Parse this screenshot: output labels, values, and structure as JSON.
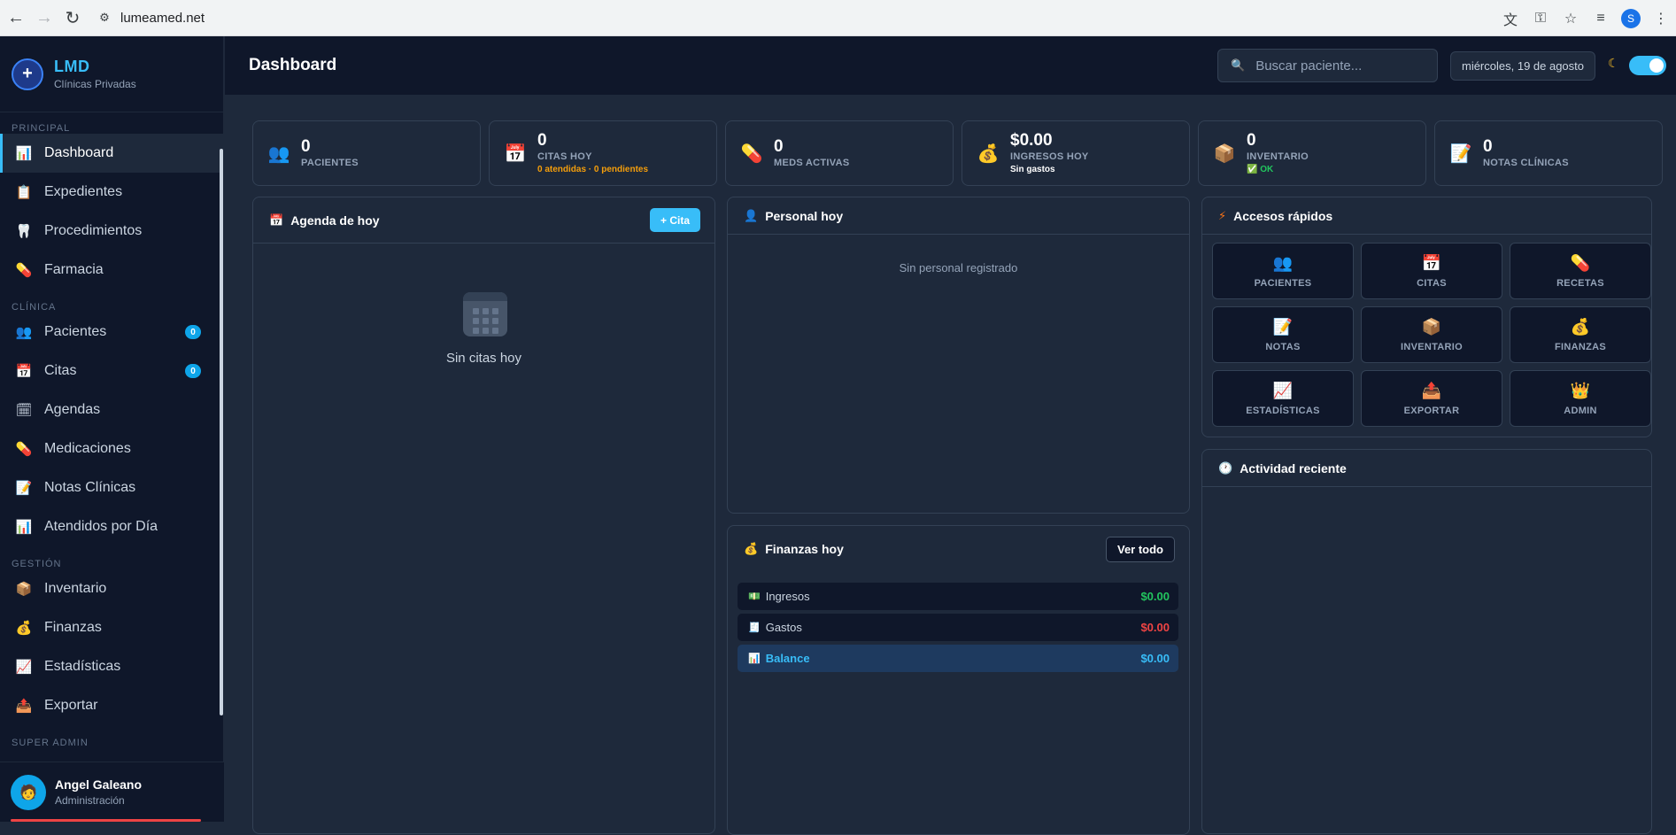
{
  "browser": {
    "url": "lumeamed.net",
    "profile_initial": "S"
  },
  "brand": {
    "name": "LMD",
    "subtitle": "Clínicas Privadas"
  },
  "sidebar": {
    "sections": [
      {
        "title": "PRINCIPAL",
        "items": [
          {
            "label": "Dashboard",
            "icon": "📊",
            "active": true
          },
          {
            "label": "Expedientes",
            "icon": "📋"
          },
          {
            "label": "Procedimientos",
            "icon": "🦷"
          },
          {
            "label": "Farmacia",
            "icon": "💊"
          }
        ]
      },
      {
        "title": "CLÍNICA",
        "items": [
          {
            "label": "Pacientes",
            "icon": "👥",
            "badge": "0"
          },
          {
            "label": "Citas",
            "icon": "📅",
            "badge": "0"
          },
          {
            "label": "Agendas",
            "icon": "🗓"
          },
          {
            "label": "Medicaciones",
            "icon": "💊"
          },
          {
            "label": "Notas Clínicas",
            "icon": "📝"
          },
          {
            "label": "Atendidos por Día",
            "icon": "📊"
          }
        ]
      },
      {
        "title": "GESTIÓN",
        "items": [
          {
            "label": "Inventario",
            "icon": "📦"
          },
          {
            "label": "Finanzas",
            "icon": "💰"
          },
          {
            "label": "Estadísticas",
            "icon": "📈"
          },
          {
            "label": "Exportar",
            "icon": "📤"
          }
        ]
      },
      {
        "title": "SUPER ADMIN",
        "items": []
      }
    ],
    "user": {
      "name": "Angel Galeano",
      "role": "Administración",
      "avatar_icon": "🧑"
    }
  },
  "header": {
    "title": "Dashboard",
    "search_placeholder": "Buscar paciente...",
    "date": "miércoles, 19 de agosto"
  },
  "stats": [
    {
      "value": "0",
      "label": "PACIENTES",
      "icon": "👥"
    },
    {
      "value": "0",
      "label": "CITAS HOY",
      "icon": "📅",
      "sub": "0 atendidas · 0 pendientes"
    },
    {
      "value": "0",
      "label": "MEDS ACTIVAS",
      "icon": "💊"
    },
    {
      "value": "$0.00",
      "label": "INGRESOS HOY",
      "icon": "💰",
      "sub": "Sin gastos"
    },
    {
      "value": "0",
      "label": "INVENTARIO",
      "icon": "📦",
      "sub": "✅ OK"
    },
    {
      "value": "0",
      "label": "NOTAS CLÍNICAS",
      "icon": "📝"
    }
  ],
  "agenda": {
    "title": "Agenda de hoy",
    "icon": "📅",
    "button": "+ Cita",
    "empty": "Sin citas hoy"
  },
  "personal": {
    "title": "Personal hoy",
    "icon": "👤",
    "empty": "Sin personal registrado"
  },
  "finanzas": {
    "title": "Finanzas hoy",
    "icon": "💰",
    "button": "Ver todo",
    "rows": [
      {
        "label": "Ingresos",
        "icon": "💵",
        "amount": "$0.00"
      },
      {
        "label": "Gastos",
        "icon": "🧾",
        "amount": "$0.00"
      },
      {
        "label": "Balance",
        "icon": "📊",
        "amount": "$0.00"
      }
    ]
  },
  "accesos": {
    "title": "Accesos rápidos",
    "icon": "⚡",
    "items": [
      {
        "label": "PACIENTES",
        "icon": "👥"
      },
      {
        "label": "CITAS",
        "icon": "📅"
      },
      {
        "label": "RECETAS",
        "icon": "💊"
      },
      {
        "label": "NOTAS",
        "icon": "📝"
      },
      {
        "label": "INVENTARIO",
        "icon": "📦"
      },
      {
        "label": "FINANZAS",
        "icon": "💰"
      },
      {
        "label": "ESTADÍSTICAS",
        "icon": "📈"
      },
      {
        "label": "EXPORTAR",
        "icon": "📤"
      },
      {
        "label": "ADMIN",
        "icon": "👑"
      }
    ]
  },
  "actividad": {
    "title": "Actividad reciente",
    "icon": "🕐"
  },
  "colors": {
    "accent": "#38bdf8",
    "bg": "#1e293b",
    "sidebar": "#0f172a",
    "warning": "#f59e0b",
    "success": "#22c55e",
    "danger": "#ef4444"
  }
}
